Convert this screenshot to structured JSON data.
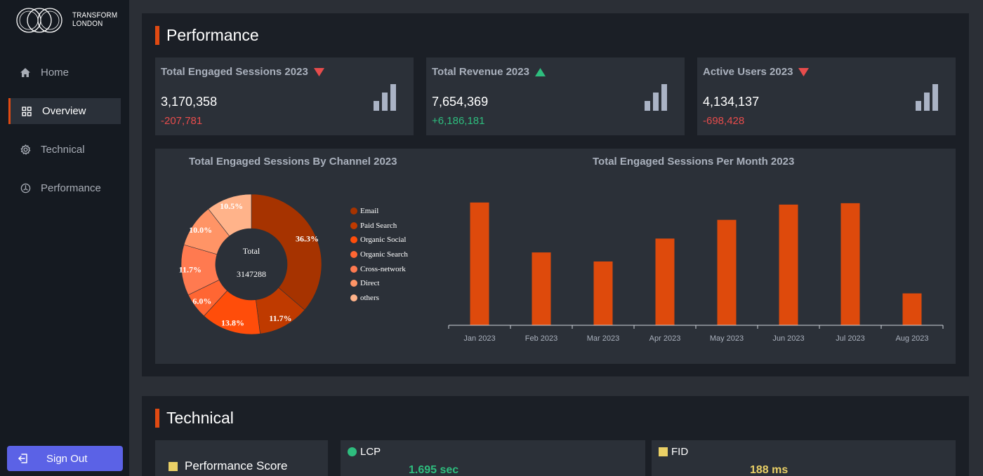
{
  "brand": {
    "line1": "TRANSFORM",
    "line2": "LONDON"
  },
  "sidebar": {
    "items": [
      {
        "label": "Home",
        "icon": "home-icon",
        "active": false
      },
      {
        "label": "Overview",
        "icon": "grid-icon",
        "active": true
      },
      {
        "label": "Technical",
        "icon": "gear-icon",
        "active": false
      },
      {
        "label": "Performance",
        "icon": "gauge-icon",
        "active": false
      }
    ],
    "signout_label": "Sign Out"
  },
  "colors": {
    "accent": "#e04a12",
    "negative": "#e74c4c",
    "positive": "#2ebd7e",
    "signout": "#5b62e6"
  },
  "performance": {
    "title": "Performance",
    "cards": [
      {
        "title": "Total Engaged Sessions 2023",
        "trend": "down",
        "value": "3,170,358",
        "delta": "-207,781",
        "delta_sign": "neg"
      },
      {
        "title": "Total Revenue 2023",
        "trend": "up",
        "value": "7,654,369",
        "delta": "+6,186,181",
        "delta_sign": "pos"
      },
      {
        "title": "Active Users 2023",
        "trend": "down",
        "value": "4,134,137",
        "delta": "-698,428",
        "delta_sign": "neg"
      }
    ]
  },
  "chart_data": [
    {
      "type": "pie",
      "title": "Total Engaged Sessions By Channel 2023",
      "center_label": "Total",
      "center_value": "3147288",
      "slices": [
        {
          "name": "Email",
          "value": 36.3,
          "label": "36.3%",
          "color": "#a63300"
        },
        {
          "name": "Paid Search",
          "value": 11.7,
          "label": "11.7%",
          "color": "#bf3a00"
        },
        {
          "name": "Organic Social",
          "value": 13.8,
          "label": "13.8%",
          "color": "#ff4d0a"
        },
        {
          "name": "Organic Search",
          "value": 6.0,
          "label": "6.0%",
          "color": "#ff6633"
        },
        {
          "name": "Cross-network",
          "value": 11.7,
          "label": "11.7%",
          "color": "#ff7a50"
        },
        {
          "name": "Direct",
          "value": 10.0,
          "label": "10.0%",
          "color": "#ff9466"
        },
        {
          "name": "others",
          "value": 10.5,
          "label": "10.5%",
          "color": "#ffb38a"
        }
      ]
    },
    {
      "type": "bar",
      "title": "Total Engaged Sessions Per Month 2023",
      "categories": [
        "Jan 2023",
        "Feb 2023",
        "Mar 2023",
        "Apr 2023",
        "May 2023",
        "Jun 2023",
        "Jul 2023",
        "Aug 2023"
      ],
      "values": [
        177,
        105,
        92,
        125,
        152,
        174,
        176,
        46
      ],
      "ylim": [
        0,
        190
      ],
      "color": "#de4a0c"
    }
  ],
  "technical": {
    "title": "Technical",
    "score_label": "Performance Score",
    "lcp_label": "LCP",
    "lcp_value": "1.695 sec",
    "fid_label": "FID",
    "fid_value": "188 ms"
  }
}
